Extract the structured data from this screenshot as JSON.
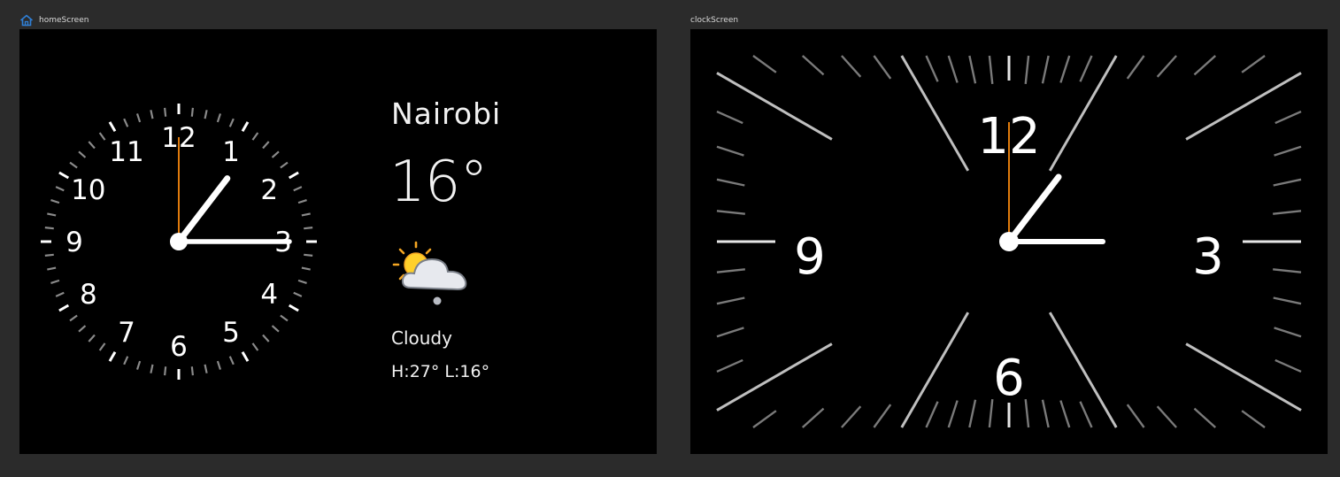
{
  "screens": {
    "home": {
      "label": "homeScreen",
      "icon": "home-icon"
    },
    "clock": {
      "label": "clockScreen"
    }
  },
  "weather": {
    "city": "Nairobi",
    "temperature": "16°",
    "condition": "Cloudy",
    "high_low": "H:27° L:16°",
    "icon": "partly-cloudy-icon"
  },
  "clock": {
    "hour": 1,
    "minute": 15,
    "second": 0,
    "dial_numbers": [
      "12",
      "1",
      "2",
      "3",
      "4",
      "5",
      "6",
      "7",
      "8",
      "9",
      "10",
      "11"
    ],
    "big_dial_numbers": [
      "12",
      "3",
      "6",
      "9"
    ]
  },
  "colors": {
    "background": "#2b2b2b",
    "screen": "#000000",
    "hands": "#ffffff",
    "second_hand": "#e07b0c",
    "home_icon": "#2f7fd6"
  }
}
